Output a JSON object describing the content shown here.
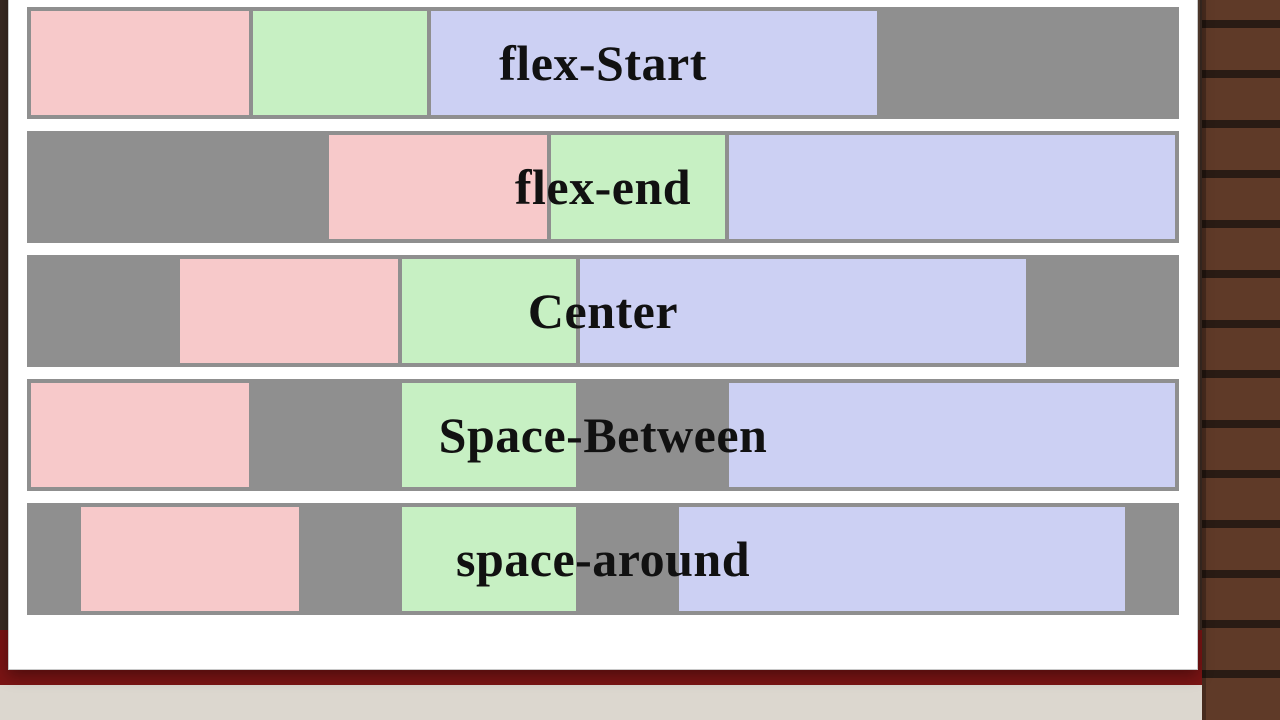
{
  "rows": [
    {
      "id": "flex-start",
      "label": "flex-Start",
      "class": "jc-start"
    },
    {
      "id": "flex-end",
      "label": "flex-end",
      "class": "jc-end"
    },
    {
      "id": "center",
      "label": "Center",
      "class": "jc-center"
    },
    {
      "id": "space-between",
      "label": "Space-Between",
      "class": "jc-between"
    },
    {
      "id": "space-around",
      "label": "space-around",
      "class": "jc-around"
    }
  ],
  "colors": {
    "track": "#8f8f8f",
    "pink": "#f7c9ca",
    "green": "#c7f0c3",
    "blue": "#ccd0f3"
  }
}
